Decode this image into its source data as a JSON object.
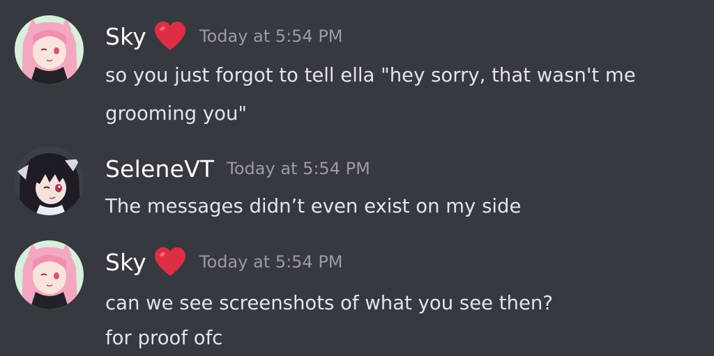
{
  "messages": [
    {
      "author": "Sky",
      "badge_icon": "red-heart-icon",
      "timestamp": "Today at 5:54 PM",
      "lines": [
        "so you just forgot to tell ella \"hey sorry, that wasn't me",
        "grooming you\""
      ]
    },
    {
      "author": "SeleneVT",
      "timestamp": "Today at 5:54 PM",
      "lines": [
        "The messages didn’t even exist on my side"
      ]
    },
    {
      "author": "Sky",
      "badge_icon": "red-heart-icon",
      "timestamp": "Today at 5:54 PM",
      "lines": [
        "can we see screenshots of what you see then?",
        "for proof ofc"
      ]
    }
  ],
  "colors": {
    "background": "#36393f",
    "username": "#ffffff",
    "timestamp": "#9a9ca1",
    "message_text": "#e3e5e8",
    "heart": "#dd2e44"
  }
}
